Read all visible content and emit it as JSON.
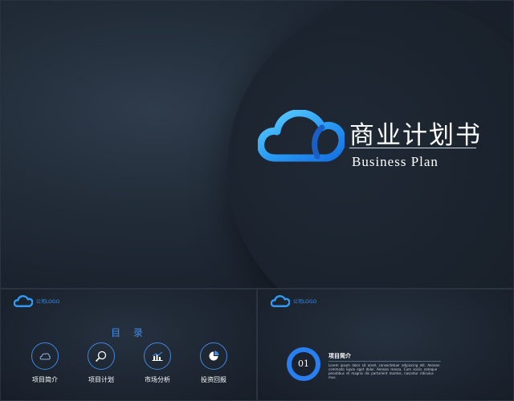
{
  "hero": {
    "title": "商业计划书",
    "subtitle": "Business Plan",
    "logo_icon": "cloud-icon",
    "accent_color": "#2f9bf5"
  },
  "toc_slide": {
    "company": "公司LOGO",
    "heading": "目 录",
    "items": [
      {
        "label": "项目简介",
        "icon": "cloud-icon"
      },
      {
        "label": "项目计划",
        "icon": "search-icon"
      },
      {
        "label": "市场分析",
        "icon": "bar-chart-icon"
      },
      {
        "label": "投资回报",
        "icon": "pie-chart-icon"
      }
    ]
  },
  "detail_slide": {
    "company": "公司LOGO",
    "number": "01",
    "title": "项目简介",
    "body": "Lorem ipsum dolor sit amet, consectetuer adipiscing elit. Aenean commodo ligula eget dolor. Aenean massa. Cum sociis natoque penatibus et magnis dis parturient montes, nascetur ridiculus mus."
  }
}
